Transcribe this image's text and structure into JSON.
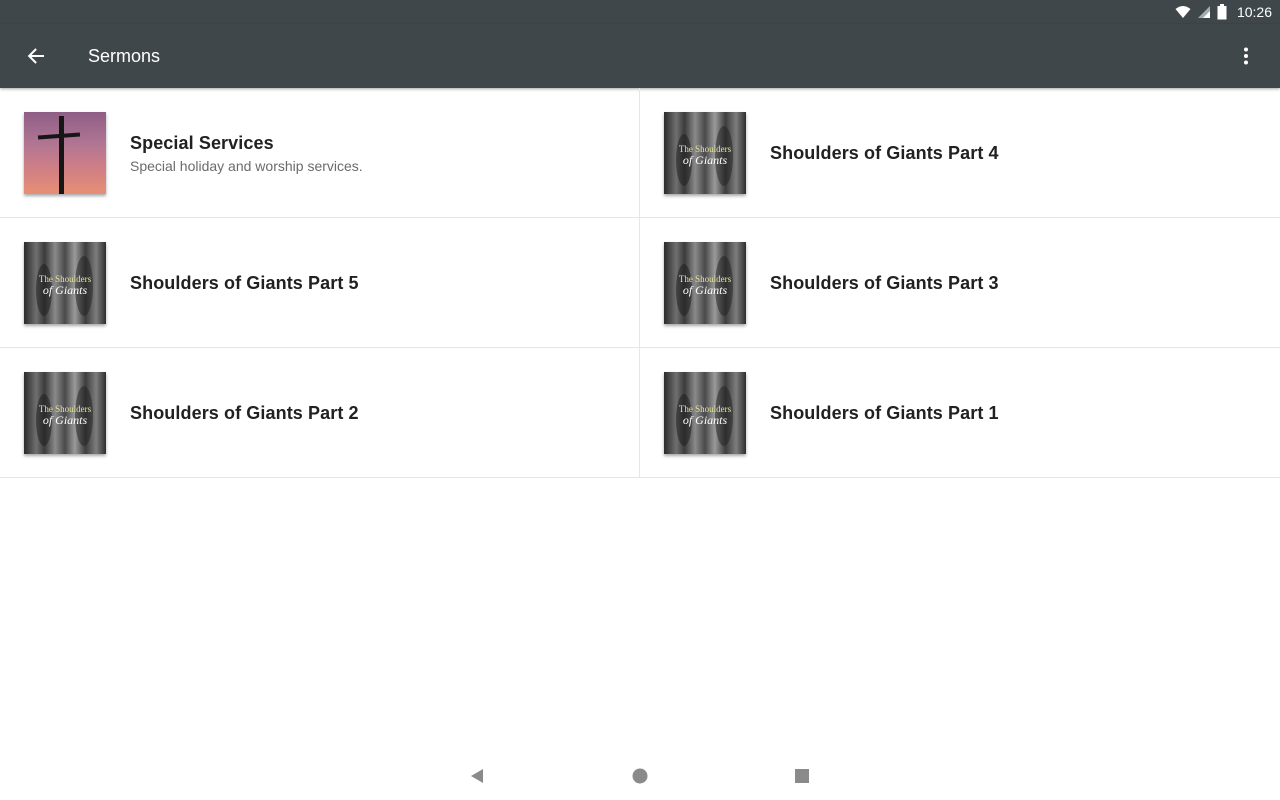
{
  "status_bar": {
    "time": "10:26",
    "icons": [
      "wifi-icon",
      "signal-icon",
      "battery-icon"
    ]
  },
  "app_bar": {
    "title": "Sermons",
    "back_icon": "arrow-back-icon",
    "menu_icon": "more-vert-icon",
    "background": "#40474b"
  },
  "sermon_series": [
    {
      "title": "Special Services",
      "subtitle": "Special holiday and worship services.",
      "artwork": "cross-sunset"
    },
    {
      "title": "Shoulders of Giants Part 4",
      "subtitle": "",
      "artwork": "shoulders-of-giants"
    },
    {
      "title": "Shoulders of Giants Part 5",
      "subtitle": "",
      "artwork": "shoulders-of-giants"
    },
    {
      "title": "Shoulders of Giants Part 3",
      "subtitle": "",
      "artwork": "shoulders-of-giants"
    },
    {
      "title": "Shoulders of Giants Part 2",
      "subtitle": "",
      "artwork": "shoulders-of-giants"
    },
    {
      "title": "Shoulders of Giants Part 1",
      "subtitle": "",
      "artwork": "shoulders-of-giants"
    }
  ],
  "artwork_text": {
    "line1": "The Shoulders",
    "line2": "of Giants"
  },
  "nav_bar": {
    "icons": [
      "nav-back-icon",
      "nav-home-icon",
      "nav-recents-icon"
    ]
  }
}
